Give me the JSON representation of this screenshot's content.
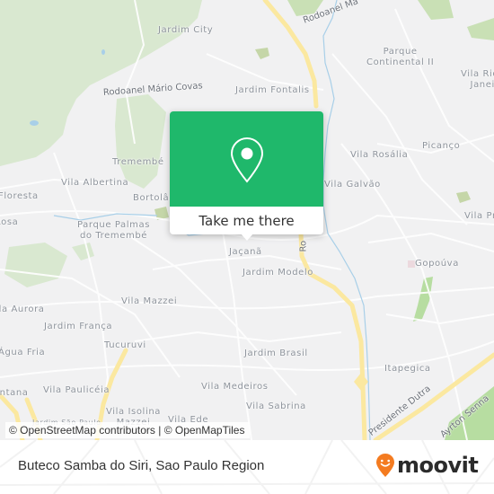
{
  "map": {
    "colors": {
      "background": "#f1f1f2",
      "forest": "#d9e8d0",
      "park": "#c9e0b5",
      "highway": "#fbe8a0",
      "road": "#ffffff",
      "water": "#a8cfe8",
      "label": "#8d939b"
    },
    "places": [
      {
        "name": "Jardim City"
      },
      {
        "name": "Parque\nContinental II"
      },
      {
        "name": "Vila Rio de\nJaneiro"
      },
      {
        "name": "Jardim Fontalis"
      },
      {
        "name": "Picanço"
      },
      {
        "name": "Vila Rosália"
      },
      {
        "name": "Vila Galvão"
      },
      {
        "name": "Tremembé"
      },
      {
        "name": "Vila Albertina"
      },
      {
        "name": "Bortolândia"
      },
      {
        "name": "Floresta"
      },
      {
        "name": "Rosa"
      },
      {
        "name": "Parque Palmas\ndo Tremembé"
      },
      {
        "name": "Jaçanã"
      },
      {
        "name": "Vila Pr"
      },
      {
        "name": "Gopoúva"
      },
      {
        "name": "Jardim Modelo"
      },
      {
        "name": "Vila Mazzei"
      },
      {
        "name": "Vila Aurora"
      },
      {
        "name": "Jardim França"
      },
      {
        "name": "Tucuruvi"
      },
      {
        "name": "Água Fria"
      },
      {
        "name": "Jardim Brasil"
      },
      {
        "name": "Itapegica"
      },
      {
        "name": "Santana"
      },
      {
        "name": "Vila Paulicéia"
      },
      {
        "name": "Vila Medeiros"
      },
      {
        "name": "Vila Sabrina"
      },
      {
        "name": "Vila Isolina\nMazzei"
      },
      {
        "name": "Vila Ede"
      },
      {
        "name": "Jardim São Paulo"
      }
    ],
    "roads": [
      {
        "name": "Rodoanel Mário Covas"
      },
      {
        "name": "Rodoanel Má"
      },
      {
        "name": "Ro"
      },
      {
        "name": "Presidente Dutra"
      },
      {
        "name": "Ayrton Senna"
      }
    ],
    "popup": {
      "icon": "map-pin-icon",
      "button_label": "Take me there"
    },
    "attribution": "© OpenStreetMap contributors | © OpenMapTiles"
  },
  "footer": {
    "title": "Buteco Samba do Siri, Sao Paulo Region",
    "logo_text": "moovit",
    "logo_color": "#f47b20"
  }
}
